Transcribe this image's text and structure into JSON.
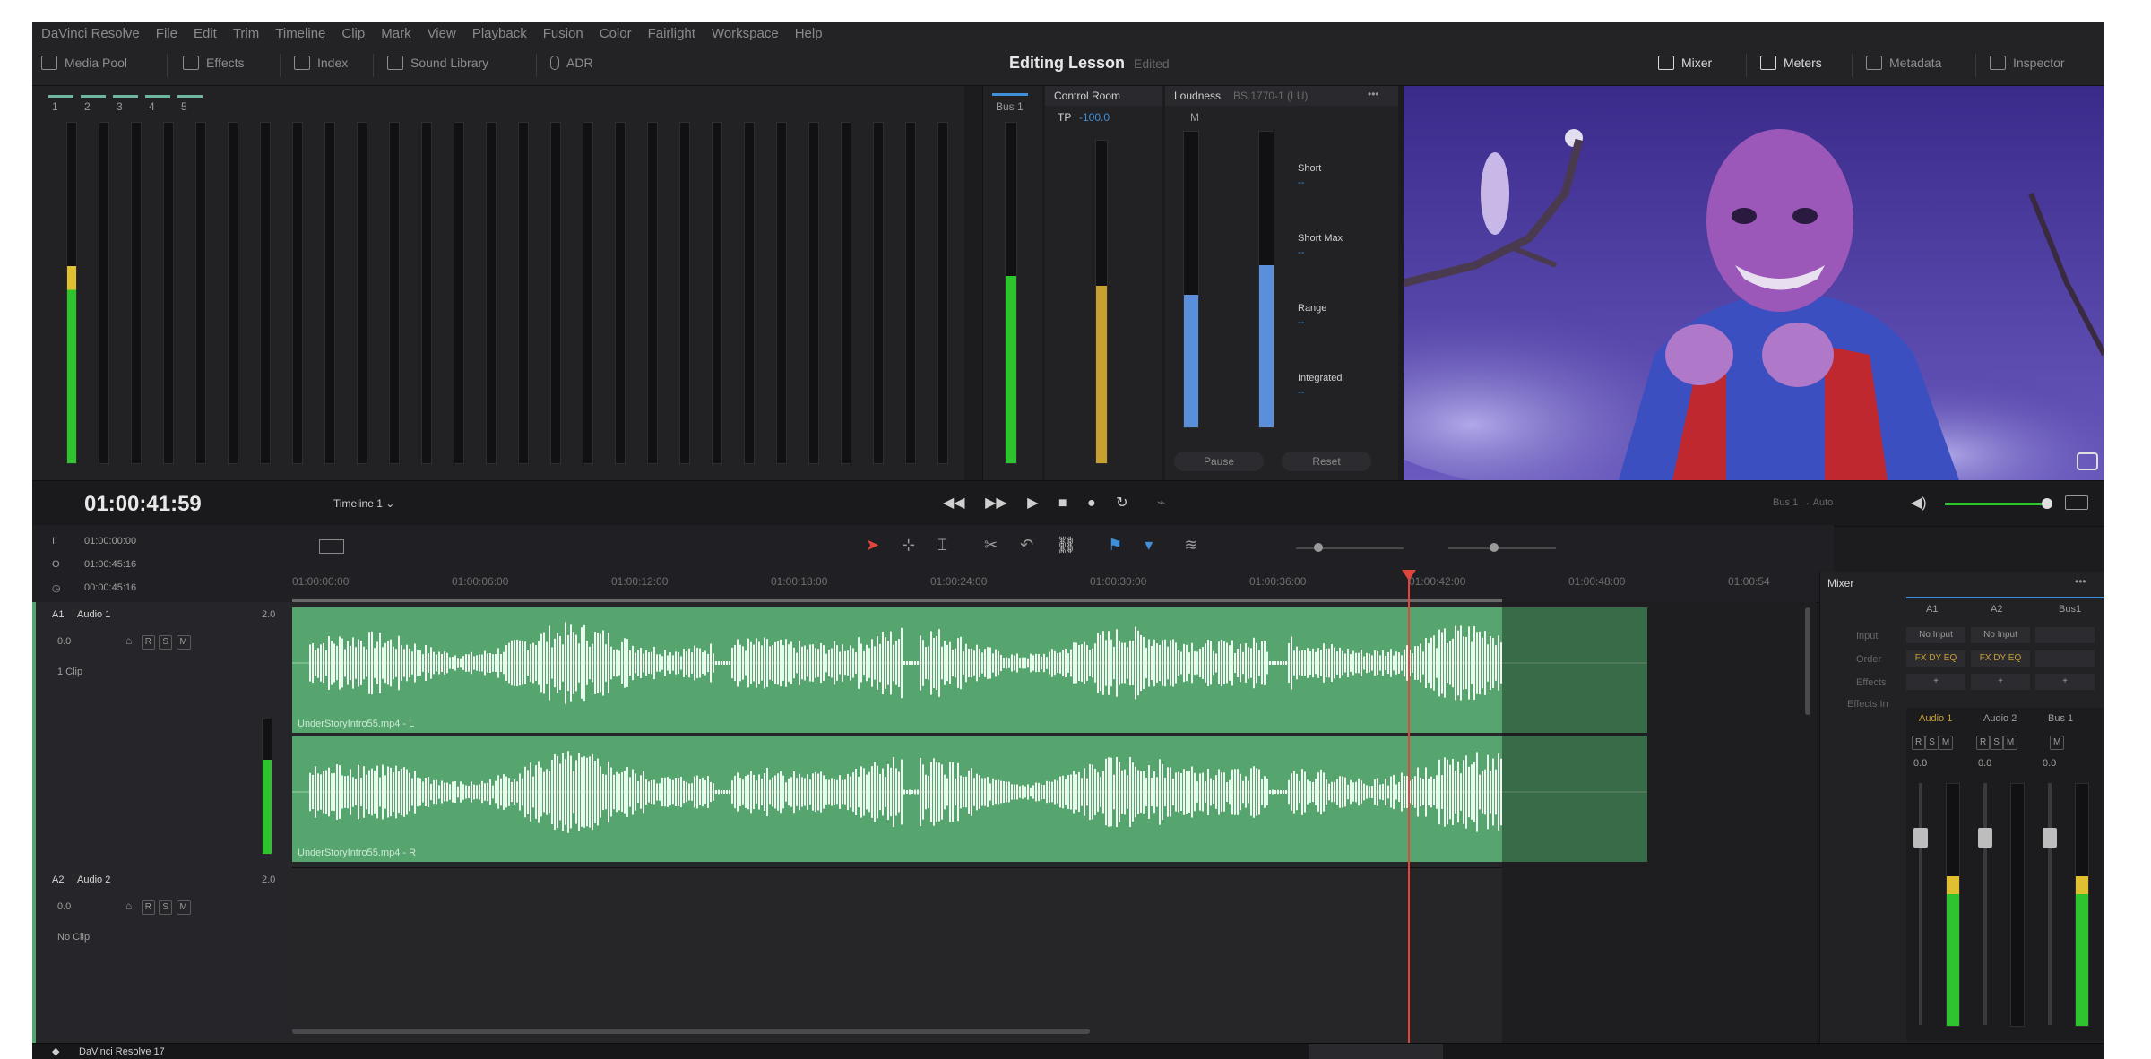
{
  "menu": [
    "DaVinci Resolve",
    "File",
    "Edit",
    "Trim",
    "Timeline",
    "Clip",
    "Mark",
    "View",
    "Playback",
    "Fusion",
    "Color",
    "Fairlight",
    "Workspace",
    "Help"
  ],
  "toolbar": {
    "media_pool": "Media Pool",
    "effects": "Effects",
    "index": "Index",
    "sound_library": "Sound Library",
    "adr": "ADR",
    "project": "Editing Lesson",
    "project_state": "Edited",
    "mixer": "Mixer",
    "meters": "Meters",
    "metadata": "Metadata",
    "inspector": "Inspector"
  },
  "meters": {
    "channels": [
      "1",
      "2",
      "3",
      "4",
      "5"
    ],
    "scale": [
      "0",
      "-5",
      "-10",
      "-15",
      "-20",
      "-30",
      "-40",
      "-50"
    ],
    "bus_label": "Bus 1",
    "control_room": "Control Room",
    "tp_label": "TP",
    "tp_value": "-100.0",
    "loudness_title": "Loudness",
    "loudness_std": "BS.1770-1 (LU)",
    "m_label": "M",
    "short": "Short",
    "short_val": "--",
    "short_max": "Short Max",
    "short_max_val": "--",
    "range": "Range",
    "range_val": "--",
    "integrated": "Integrated",
    "integrated_val": "--",
    "pause": "Pause",
    "reset": "Reset",
    "level_ch1": 0.58,
    "level_bus": 0.55,
    "level_cr": 0.55,
    "level_loud_a": 0.45,
    "level_loud_b": 0.55
  },
  "transport": {
    "timecode": "01:00:41:59",
    "timeline": "Timeline 1",
    "bus_route": "Bus 1",
    "route_arrow": "→",
    "auto": "Auto",
    "volume_level": 0.95
  },
  "marks": [
    {
      "icon": "I",
      "value": "01:00:00:00"
    },
    {
      "icon": "O",
      "value": "01:00:45:16"
    },
    {
      "icon": "◷",
      "value": "00:00:45:16"
    }
  ],
  "ruler": [
    "01:00:00:00",
    "01:00:06:00",
    "01:00:12:00",
    "01:00:18:00",
    "01:00:24:00",
    "01:00:30:00",
    "01:00:36:00",
    "01:00:42:00",
    "01:00:48:00",
    "01:00:54"
  ],
  "tracks": [
    {
      "id": "A1",
      "name": "Audio 1",
      "format": "2.0",
      "vol": "0.0",
      "clips": "1 Clip"
    },
    {
      "id": "A2",
      "name": "Audio 2",
      "format": "2.0",
      "vol": "0.0",
      "clips": "No Clip"
    }
  ],
  "clips": {
    "left": "UnderStoryIntro55.mp4 - L",
    "right": "UnderStoryIntro55.mp4 - R"
  },
  "mixer": {
    "title": "Mixer",
    "more": "•••",
    "cols": [
      "A1",
      "A2",
      "Bus1"
    ],
    "row_labels": [
      "Input",
      "Order",
      "Effects",
      "Effects In"
    ],
    "input": [
      "No Input",
      "No Input"
    ],
    "order": "FX DY EQ",
    "effects_add": "+",
    "channels": [
      "Audio 1",
      "Audio 2",
      "Bus 1"
    ],
    "vals": [
      "0.0",
      "0.0",
      "0.0"
    ],
    "levels": [
      0.62,
      0,
      0.62
    ],
    "fader_scale": [
      "0",
      "-5",
      "-10",
      "-15",
      "-20",
      "-30",
      "-40",
      "-50"
    ]
  },
  "status": {
    "app": "DaVinci Resolve 17"
  },
  "colors": {
    "meter": "#2ec42e",
    "accent": "#3f8fd9",
    "playhead": "#e0463c",
    "clip": "#56a56e",
    "loud": "#5a8fdc",
    "cr": "#c8a030"
  }
}
